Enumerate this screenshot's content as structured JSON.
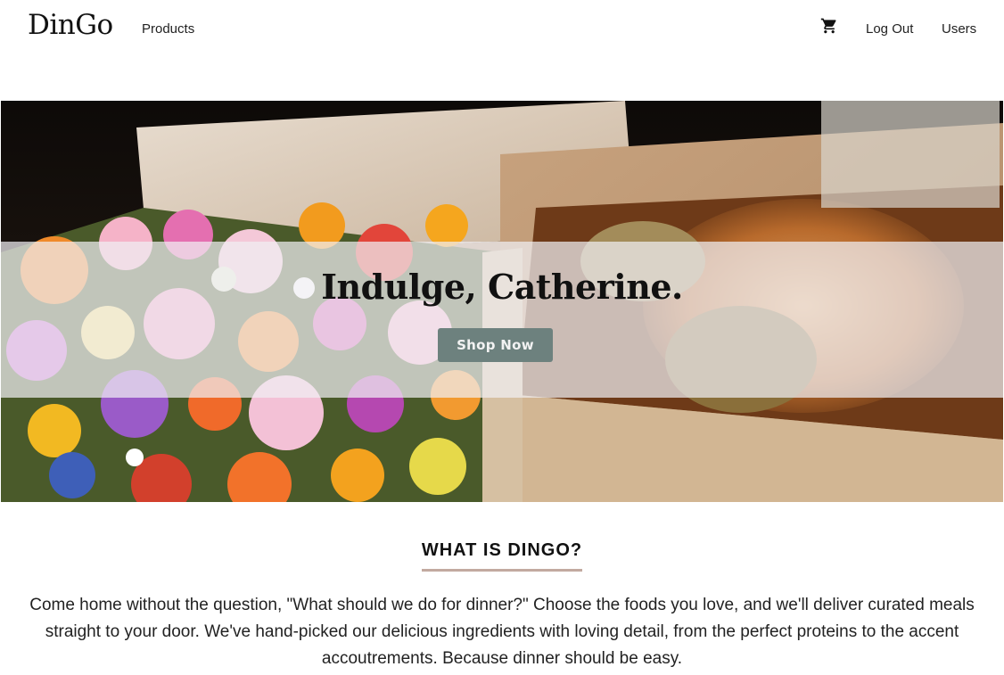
{
  "nav": {
    "brand": "DinGo",
    "products_label": "Products",
    "cart_icon": "shopping-cart-icon",
    "logout_label": "Log Out",
    "users_label": "Users"
  },
  "hero": {
    "title": "Indulge, Catherine.",
    "button_label": "Shop Now",
    "image_description_icon": "bento-box-photo"
  },
  "about": {
    "heading": "WHAT IS DINGO?",
    "body": "Come home without the question, \"What should we do for dinner?\" Choose the foods you love, and we'll deliver curated meals straight to your door. We've hand-picked our delicious ingredients with loving detail, from the perfect proteins to the accent accoutrements. Because dinner should be easy."
  },
  "colors": {
    "button_bg": "#6d817e",
    "heading_underline": "#c2aaa0",
    "band_overlay": "#f0eef2"
  }
}
